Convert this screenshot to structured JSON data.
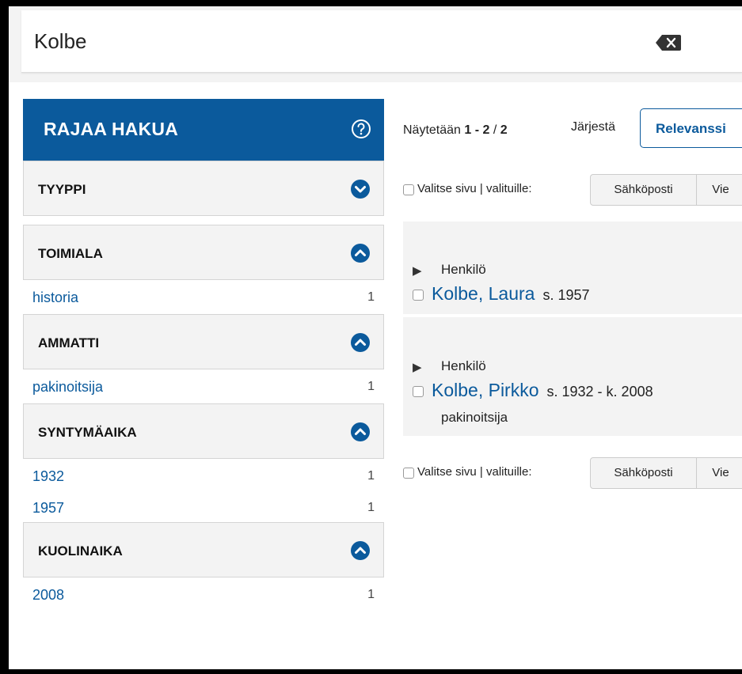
{
  "search": {
    "query": "Kolbe"
  },
  "sidebar": {
    "title": "RAJAA HAKUA",
    "facets": [
      {
        "label": "TYYPPI",
        "expanded": false,
        "items": []
      },
      {
        "label": "TOIMIALA",
        "expanded": true,
        "items": [
          {
            "value": "historia",
            "count": "1"
          }
        ]
      },
      {
        "label": "AMMATTI",
        "expanded": true,
        "items": [
          {
            "value": "pakinoitsija",
            "count": "1"
          }
        ]
      },
      {
        "label": "SYNTYMÄAIKA",
        "expanded": true,
        "items": [
          {
            "value": "1932",
            "count": "1"
          },
          {
            "value": "1957",
            "count": "1"
          }
        ]
      },
      {
        "label": "KUOLINAIKA",
        "expanded": true,
        "items": [
          {
            "value": "2008",
            "count": "1"
          }
        ]
      }
    ]
  },
  "results_header": {
    "showing_prefix": "Näytetään ",
    "range": "1 - 2",
    "separator": " / ",
    "total": "2",
    "sort_label": "Järjestä",
    "sort_value": "Relevanssi"
  },
  "selection": {
    "label": "Valitse sivu | valituille:",
    "email_button": "Sähköposti",
    "export_button": "Vie"
  },
  "results": [
    {
      "type": "Henkilö",
      "name": "Kolbe, Laura",
      "dates": "s. 1957",
      "occupation": ""
    },
    {
      "type": "Henkilö",
      "name": "Kolbe, Pirkko",
      "dates": "s. 1932 - k. 2008",
      "occupation": "pakinoitsija"
    }
  ],
  "colors": {
    "accent": "#0b5a9c",
    "panel": "#f3f3f3"
  },
  "icons": {
    "clear": "backspace-icon",
    "help": "help-icon",
    "expand": "chevron-down-icon",
    "collapse": "chevron-up-icon",
    "toggle": "triangle-right-icon"
  }
}
